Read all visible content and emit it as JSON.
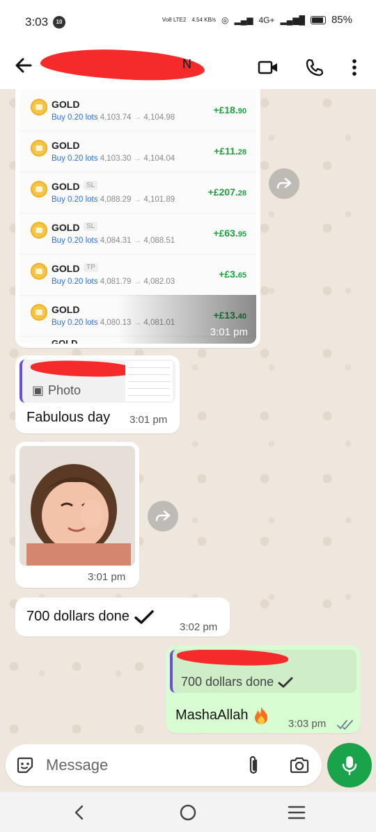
{
  "status": {
    "time": "3:03",
    "notif_count": "10",
    "volte": "Vo8 LTE2",
    "speed": "4.54 KB/s",
    "network": "4G+",
    "battery": "85%"
  },
  "header": {
    "name_tail": "N"
  },
  "trades": {
    "timestamp": "3:01 pm",
    "cut_label": "GOLD",
    "rows": [
      {
        "symbol": "GOLD",
        "tag": "",
        "side": "Buy 0.20 lots",
        "open": "4,103.74",
        "close": "4,104.98",
        "profit_main": "+£18.",
        "profit_cents": "90"
      },
      {
        "symbol": "GOLD",
        "tag": "",
        "side": "Buy 0.20 lots",
        "open": "4,103.30",
        "close": "4,104.04",
        "profit_main": "+£11.",
        "profit_cents": "28"
      },
      {
        "symbol": "GOLD",
        "tag": "SL",
        "side": "Buy 0.20 lots",
        "open": "4,088.29",
        "close": "4,101.89",
        "profit_main": "+£207.",
        "profit_cents": "28"
      },
      {
        "symbol": "GOLD",
        "tag": "SL",
        "side": "Buy 0.20 lots",
        "open": "4,084.31",
        "close": "4,088.51",
        "profit_main": "+£63.",
        "profit_cents": "95"
      },
      {
        "symbol": "GOLD",
        "tag": "TP",
        "side": "Buy 0.20 lots",
        "open": "4,081.79",
        "close": "4,082.03",
        "profit_main": "+£3.",
        "profit_cents": "65"
      },
      {
        "symbol": "GOLD",
        "tag": "",
        "side": "Buy 0.20 lots",
        "open": "4,080.13",
        "close": "4,081.01",
        "profit_main": "+£13.",
        "profit_cents": "40"
      }
    ]
  },
  "reply_msg": {
    "quote_label": "Photo",
    "text": "Fabulous day",
    "time": "3:01 pm"
  },
  "photo_msg": {
    "time": "3:01 pm"
  },
  "text_msg": {
    "text": "700 dollars done",
    "time": "3:02 pm"
  },
  "out_msg": {
    "quote_text": "700 dollars done",
    "text": "MashaAllah",
    "time": "3:03 pm"
  },
  "composer": {
    "placeholder": "Message"
  },
  "colors": {
    "accent": "#1aa34a",
    "outgoing": "#d9fdd3",
    "profit": "#1e9e3e",
    "quote_bar": "#6b4fd8"
  }
}
